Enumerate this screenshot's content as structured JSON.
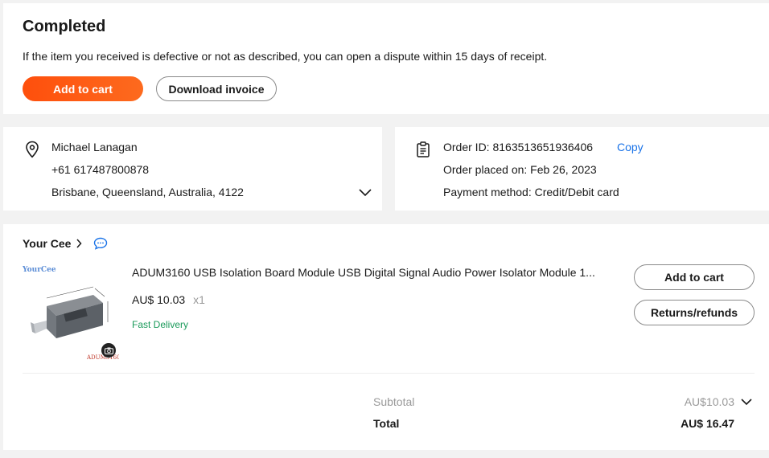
{
  "status": {
    "title": "Completed",
    "note": "If the item you received is defective or not as described, you can open a dispute within 15 days of receipt.",
    "add_to_cart_label": "Add to cart",
    "download_invoice_label": "Download invoice"
  },
  "address": {
    "name": "Michael Lanagan",
    "phone": "+61 617487800878",
    "location": "Brisbane, Queensland, Australia, 4122"
  },
  "order": {
    "id_text": "Order ID: 8163513651936406",
    "copy_label": "Copy",
    "placed_text": "Order placed on: Feb 26, 2023",
    "payment_text": "Payment method: Credit/Debit card"
  },
  "item": {
    "store_name": "Your Cee",
    "title": "ADUM3160 USB Isolation Board Module USB Digital Signal Audio Power Isolator Module 1...",
    "price": "AU$ 10.03",
    "quantity": "x1",
    "delivery": "Fast Delivery",
    "add_to_cart_label": "Add to cart",
    "returns_label": "Returns/refunds",
    "image_brand": "YourCee",
    "image_caption": "ADUM3160"
  },
  "summary": {
    "subtotal_label": "Subtotal",
    "subtotal_value": "AU$10.03",
    "total_label": "Total",
    "total_value": "AU$ 16.47"
  },
  "colors": {
    "accent": "#fe4f0c",
    "link": "#1a73e8",
    "delivery": "#1a9a5a"
  }
}
